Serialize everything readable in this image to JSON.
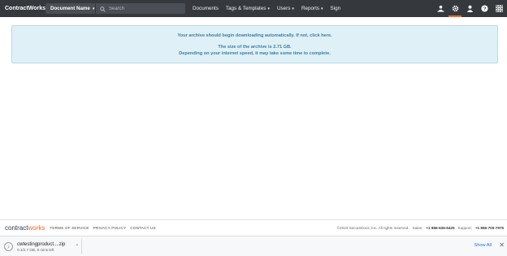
{
  "nav": {
    "brand": "ContractWorks",
    "doc_name": "Document Name",
    "search_placeholder": "Search",
    "links": [
      {
        "label": "Documents",
        "dropdown": false
      },
      {
        "label": "Tags & Templates",
        "dropdown": true
      },
      {
        "label": "Users",
        "dropdown": true
      },
      {
        "label": "Reports",
        "dropdown": true
      },
      {
        "label": "Sign",
        "dropdown": false
      }
    ],
    "icons": [
      "upload-user-icon",
      "gear-icon",
      "user-icon",
      "help-icon",
      "apps-grid-icon"
    ],
    "accent_color": "#f26a2c"
  },
  "alert": {
    "line1_text": "Your archive should begin downloading automatically. If not, ",
    "line1_link": "click here",
    "line1_end": ".",
    "line2": "The size of the archive is 2.71 GB.",
    "line3": "Depending on your internet speed, it may take some time to complete."
  },
  "footer": {
    "logo_main": "contract",
    "logo_accent": "works",
    "links": [
      "TERMS OF SERVICE",
      "PRIVACY POLICY",
      "CONTACT US"
    ],
    "copyright": "©2023 SecureDocs, Inc. All rights reserved.",
    "sales_label": "Sales:",
    "sales_phone": "+1 866-636-6429",
    "support_label": "Support:",
    "support_phone": "+1 866-700-7975"
  },
  "download": {
    "filename": "cwtestingproduct....zip",
    "status": "0.1/2.7 GB, 8 mins left",
    "show_all": "Show All"
  }
}
